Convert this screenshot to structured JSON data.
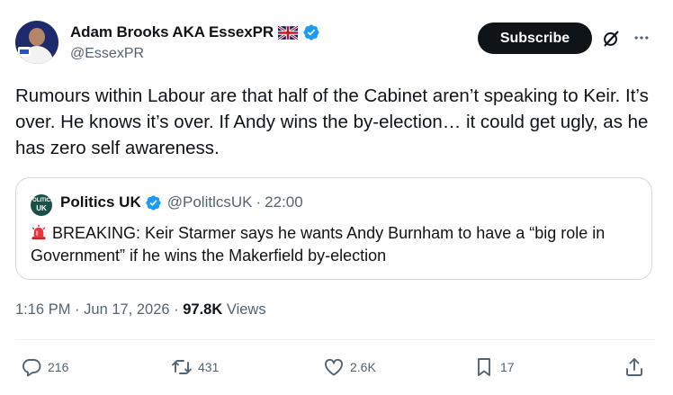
{
  "author": {
    "name": "Adam Brooks AKA EssexPR",
    "handle": "@EssexPR",
    "flag_icon": "uk-flag-icon",
    "verified_icon": "verified-badge-icon",
    "avatar_icon": "profile-photo"
  },
  "header": {
    "subscribe_label": "Subscribe",
    "grok_icon": "grok-icon",
    "more_icon": "more-icon"
  },
  "tweet": {
    "text": "Rumours within Labour are that half of the Cabinet aren’t speaking to Keir. It’s over. He knows it’s over. If Andy wins the by-election… it could get ugly, as he has zero self awareness."
  },
  "quote": {
    "avatar_line1": "POLITICS",
    "avatar_line2": "UK",
    "name": "Politics UK",
    "handle": "@PolitlcsUK",
    "separator": "·",
    "time": "22:00",
    "emoji_icon": "rotating-light-icon",
    "text": "BREAKING: Keir Starmer says he wants Andy Burnham to have a “big role in Government” if he wins the Makerfield by-election"
  },
  "meta": {
    "time": "1:16 PM",
    "dot1": "·",
    "date": "Jun 17, 2026",
    "dot2": "·",
    "views_count": "97.8K",
    "views_label": "Views"
  },
  "actions": {
    "replies": "216",
    "reposts": "431",
    "likes": "2.6K",
    "bookmarks": "17"
  },
  "colors": {
    "text_primary": "#0f1419",
    "text_secondary": "#536471",
    "verified_blue": "#1d9bf0",
    "border": "#cfd9de",
    "button_dark": "#0f1419"
  }
}
